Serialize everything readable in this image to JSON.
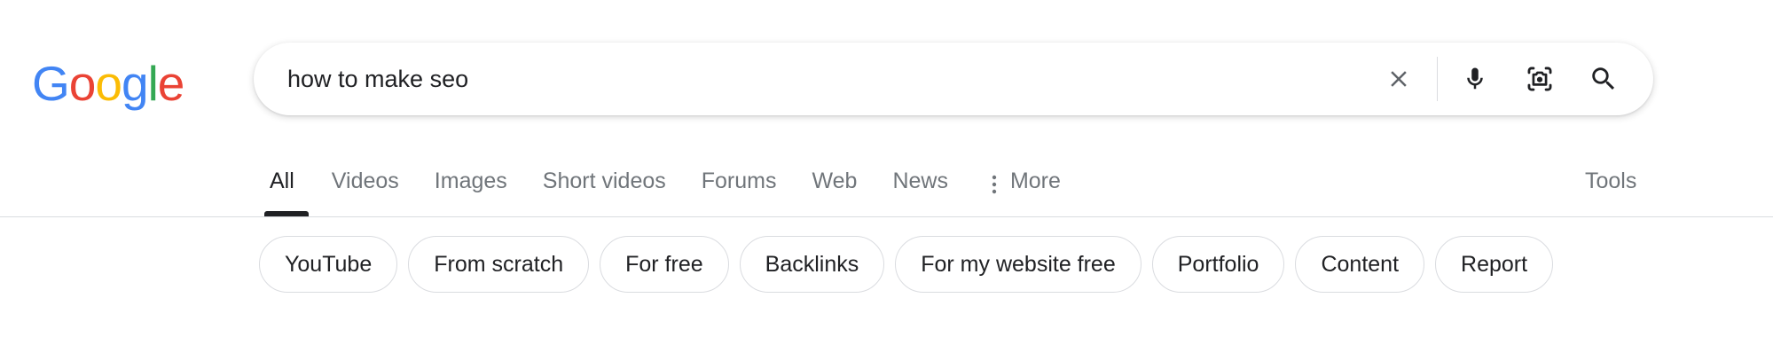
{
  "logo": {
    "letters": [
      "G",
      "o",
      "o",
      "g",
      "l",
      "e"
    ],
    "colors": [
      "#4285F4",
      "#EA4335",
      "#FBBC05",
      "#4285F4",
      "#34A853",
      "#EA4335"
    ]
  },
  "search": {
    "query": "how to make seo",
    "icons": {
      "clear": "close-icon",
      "voice": "microphone-icon",
      "lens": "camera-lens-icon",
      "submit": "search-icon"
    }
  },
  "tabs": {
    "items": [
      {
        "label": "All",
        "active": true
      },
      {
        "label": "Videos"
      },
      {
        "label": "Images"
      },
      {
        "label": "Short videos"
      },
      {
        "label": "Forums"
      },
      {
        "label": "Web"
      },
      {
        "label": "News"
      },
      {
        "label": "More",
        "icon": "more-vert-icon"
      }
    ],
    "tools_label": "Tools"
  },
  "chips": [
    "YouTube",
    "From scratch",
    "For free",
    "Backlinks",
    "For my website free",
    "Portfolio",
    "Content",
    "Report"
  ],
  "colors": {
    "text_primary": "#202124",
    "text_secondary": "#70757a",
    "icon_gray": "#5f6368",
    "border": "#dadce0"
  }
}
